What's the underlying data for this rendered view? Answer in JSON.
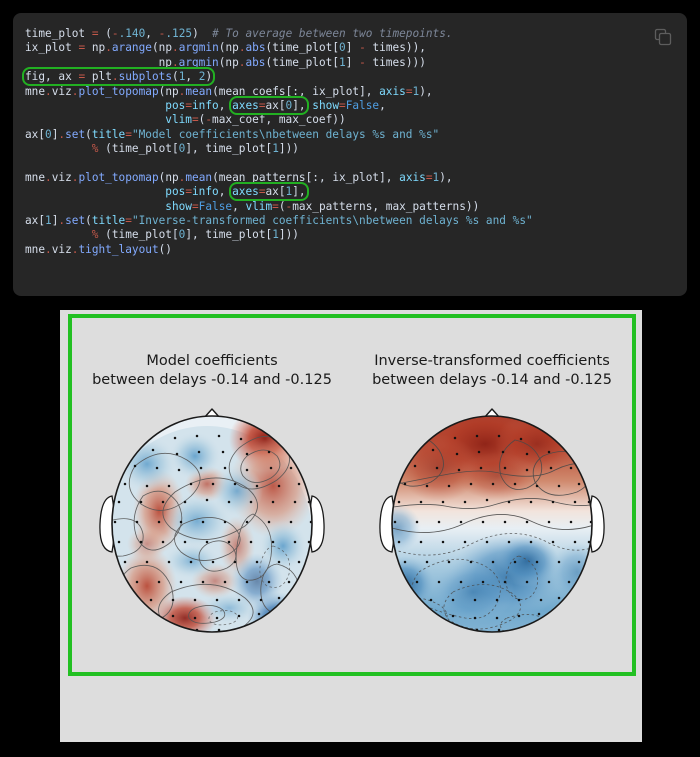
{
  "code_block": {
    "copy_icon": "copy-icon",
    "language": "python",
    "lines": [
      "time_plot = (-.140, -.125)  # To average between two timepoints.",
      "ix_plot = np.arange(np.argmin(np.abs(time_plot[0] - times)),",
      "                    np.argmin(np.abs(time_plot[1] - times)))",
      "fig, ax = plt.subplots(1, 2)",
      "mne.viz.plot_topomap(np.mean(mean_coefs[:, ix_plot], axis=1),",
      "                     pos=info, axes=ax[0], show=False,",
      "                     vlim=(-max_coef, max_coef))",
      "ax[0].set(title=\"Model coefficients\\nbetween delays %s and %s\"",
      "          % (time_plot[0], time_plot[1]))",
      "",
      "mne.viz.plot_topomap(np.mean(mean_patterns[:, ix_plot], axis=1),",
      "                     pos=info, axes=ax[1],",
      "                     show=False, vlim=(-max_patterns, max_patterns))",
      "ax[1].set(title=\"Inverse-transformed coefficients\\nbetween delays %s and %s\"",
      "          % (time_plot[0], time_plot[1]))",
      "mne.viz.tight_layout()"
    ],
    "highlights": [
      "fig, ax = plt.subplots(1, 2)",
      "axes=ax[0],",
      "axes=ax[1],"
    ]
  },
  "figure": {
    "highlight_color": "#22c022",
    "background_color": "#dddddd",
    "panels": [
      {
        "title": "Model coefficients\nbetween delays -0.14 and -0.125",
        "title_line1": "Model coefficients",
        "title_line2": "between delays -0.14 and -0.125"
      },
      {
        "title": "Inverse-transformed coefficients\nbetween delays -0.14 and -0.125",
        "title_line1": "Inverse-transformed coefficients",
        "title_line2": "between delays -0.14 and -0.125"
      }
    ]
  },
  "chart_data": {
    "type": "heatmap",
    "subtype": "eeg-topomap",
    "title": "EEG topographic maps of model coefficients and inverse-transformed coefficients",
    "colormap": "RdBu_r",
    "panels": [
      {
        "name": "Model coefficients",
        "title": "Model coefficients\nbetween delays -0.14 and -0.125",
        "time_window_s": [
          -0.14,
          -0.125
        ],
        "vlim": [
          "-max_coef",
          "max_coef"
        ],
        "description": "Noisy, spatially patchy coefficient topography with a strong positive (red) focus over the right frontal region, a strong negative (blue) focus at the right occipital/posterior region, and a positive (red) band along the left posterior-inferior edge.",
        "extrema": [
          {
            "label": "positive peak",
            "location": "right frontal",
            "polarity": "positive",
            "relative_value": 1.0
          },
          {
            "label": "negative peak",
            "location": "right occipital",
            "polarity": "negative",
            "relative_value": -0.95
          },
          {
            "label": "positive patch",
            "location": "left posterior-inferior",
            "polarity": "positive",
            "relative_value": 0.8
          },
          {
            "label": "positive patch",
            "location": "left central",
            "polarity": "positive",
            "relative_value": 0.5
          },
          {
            "label": "negative patch",
            "location": "central midline",
            "polarity": "negative",
            "relative_value": -0.4
          }
        ]
      },
      {
        "name": "Inverse-transformed coefficients",
        "title": "Inverse-transformed coefficients\nbetween delays -0.14 and -0.125",
        "time_window_s": [
          -0.14,
          -0.125
        ],
        "vlim": [
          "-max_patterns",
          "max_patterns"
        ],
        "description": "Smooth dipolar pattern: broad positive (red) activity over the entire anterior/frontal half and broad negative (blue) activity over the posterior/occipital half, with the zero-crossing contour running across the central line.",
        "extrema": [
          {
            "label": "positive peak",
            "location": "frontal midline",
            "polarity": "positive",
            "relative_value": 1.0
          },
          {
            "label": "negative peak",
            "location": "parieto-occipital",
            "polarity": "negative",
            "relative_value": -0.85
          },
          {
            "label": "negative patch",
            "location": "left temporal-posterior",
            "polarity": "negative",
            "relative_value": -0.7
          }
        ]
      }
    ],
    "axes": {
      "grid": false,
      "ticks": false,
      "colorbar": false
    },
    "legend": {
      "visible": false
    }
  }
}
